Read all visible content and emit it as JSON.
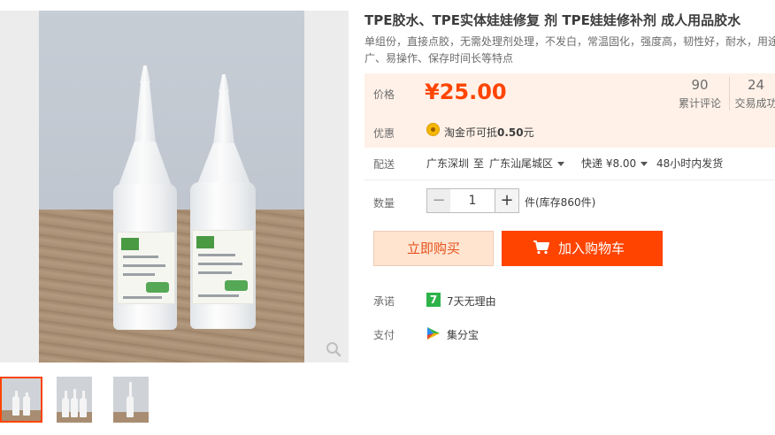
{
  "product": {
    "title": "TPE胶水、TPE实体娃娃修复 剂 TPE娃娃修补剂 成人用品胶水",
    "subtitle_line1": "单组份，直接点胶，无需处理剂处理，不发白，常温固化，强度高，韧性好，耐水，用途",
    "subtitle_line2": "广、易操作、保存时间长等特点"
  },
  "price": {
    "label": "价格",
    "value": "¥25.00",
    "stats": [
      {
        "num": "90",
        "label": "累计评论"
      },
      {
        "num": "24",
        "label": "交易成功"
      }
    ]
  },
  "promo": {
    "label": "优惠",
    "text_prefix": "淘金币可抵",
    "text_amount": "0.50",
    "text_suffix": "元",
    "icon": "taojinbi-coin-icon"
  },
  "shipping": {
    "label": "配送",
    "origin": "广东深圳",
    "to": "至",
    "destination": "广东汕尾城区",
    "method": "快递 ¥8.00",
    "dispatch": "48小时内发货"
  },
  "quantity": {
    "label": "数量",
    "value": "1",
    "minus": "−",
    "plus": "+",
    "stock": "件(库存860件)"
  },
  "actions": {
    "buy_now": "立即购买",
    "add_to_cart": "加入购物车"
  },
  "services": {
    "promise_label": "承诺",
    "promise_text": "7天无理由",
    "promise_icon_glyph": "7",
    "payment_label": "支付",
    "payment_text": "集分宝"
  },
  "colors": {
    "accent": "#ff4400",
    "price_bg": "#fff1e8",
    "buy_now_bg": "#ffe4d0",
    "service_green": "#2db34a"
  },
  "gallery": {
    "thumbnail_count": 3,
    "active_thumbnail": 1
  }
}
